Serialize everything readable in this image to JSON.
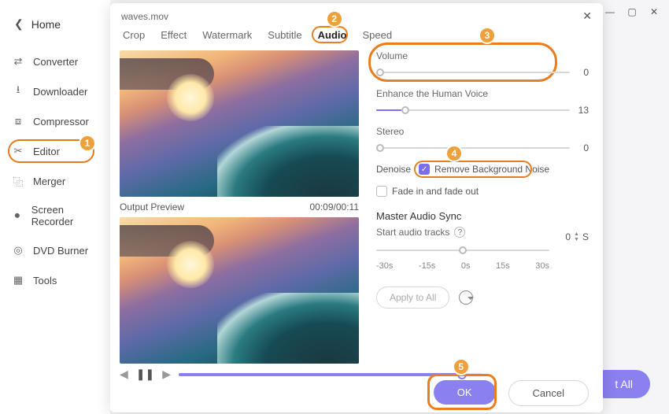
{
  "window": {
    "title": "waves.mov"
  },
  "home_label": "Home",
  "sidebar": {
    "items": [
      {
        "label": "Converter",
        "icon": "converter"
      },
      {
        "label": "Downloader",
        "icon": "downloader"
      },
      {
        "label": "Compressor",
        "icon": "compressor"
      },
      {
        "label": "Editor",
        "icon": "editor",
        "active": true
      },
      {
        "label": "Merger",
        "icon": "merger"
      },
      {
        "label": "Screen Recorder",
        "icon": "recorder"
      },
      {
        "label": "DVD Burner",
        "icon": "dvd"
      },
      {
        "label": "Tools",
        "icon": "tools"
      }
    ]
  },
  "tabs": {
    "items": [
      "Crop",
      "Effect",
      "Watermark",
      "Subtitle",
      "Audio",
      "Speed"
    ],
    "active": "Audio"
  },
  "preview": {
    "caption": "Output Preview",
    "timecode": "00:09/00:11"
  },
  "audio": {
    "volume": {
      "label": "Volume",
      "value": 0
    },
    "enhance": {
      "label": "Enhance the Human Voice",
      "value": 13
    },
    "stereo": {
      "label": "Stereo",
      "value": 0
    },
    "denoise": {
      "label": "Denoise",
      "checkbox_label": "Remove Background Noise",
      "checked": true
    },
    "fade": {
      "label": "Fade in and fade out",
      "checked": false
    },
    "master": {
      "heading": "Master Audio Sync",
      "start_label": "Start audio tracks",
      "ticks": [
        "-30s",
        "-15s",
        "0s",
        "15s",
        "30s"
      ],
      "value": 0,
      "unit": "S"
    },
    "apply_all": "Apply to All"
  },
  "footer": {
    "ok": "OK",
    "cancel": "Cancel"
  },
  "background_button": "t All",
  "steps": {
    "s1": "1",
    "s2": "2",
    "s3": "3",
    "s4": "4",
    "s5": "5"
  }
}
